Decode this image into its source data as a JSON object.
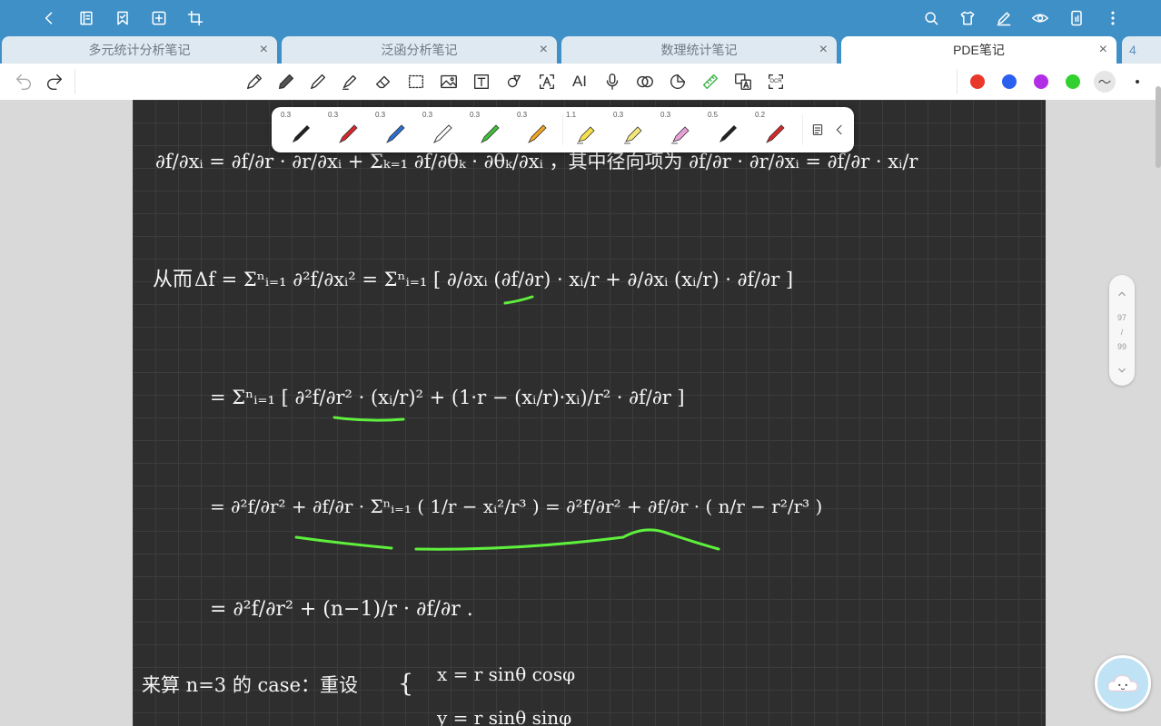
{
  "tabs": [
    {
      "label": "多元统计分析笔记",
      "active": false
    },
    {
      "label": "泛函分析笔记",
      "active": false
    },
    {
      "label": "数理统计笔记",
      "active": false
    },
    {
      "label": "PDE笔记",
      "active": true
    }
  ],
  "tabs_more_count": "4",
  "tab_close_glyph": "×",
  "colors": {
    "app_bar": "#3f90c7",
    "canvas": "#2e2e2e",
    "highlight": "#5ef03c",
    "swatches": [
      "#e8382b",
      "#2a5ff0",
      "#b22ee6",
      "#33d12f"
    ]
  },
  "pen_palette": [
    {
      "width": "0.3",
      "color": "#222222",
      "icon": "pen-icon"
    },
    {
      "width": "0.3",
      "color": "#d9262c",
      "icon": "pen-icon"
    },
    {
      "width": "0.3",
      "color": "#2c6fd1",
      "icon": "pen-icon"
    },
    {
      "width": "0.3",
      "color": "#ffffff",
      "icon": "pen-icon"
    },
    {
      "width": "0.3",
      "color": "#3fbf3a",
      "icon": "pen-icon"
    },
    {
      "width": "0.3",
      "color": "#f2a41f",
      "icon": "pen-icon"
    },
    {
      "width": "1.1",
      "color": "#f5e04a",
      "icon": "highlighter-icon"
    },
    {
      "width": "0.3",
      "color": "#f2e57a",
      "icon": "highlighter-icon"
    },
    {
      "width": "0.3",
      "color": "#e9a0d6",
      "icon": "highlighter-icon"
    },
    {
      "width": "0.5",
      "color": "#222222",
      "icon": "pen-icon"
    },
    {
      "width": "0.2",
      "color": "#d9262c",
      "icon": "pen-icon"
    }
  ],
  "page_indicator": {
    "current": "97",
    "separator": "/",
    "total": "99"
  },
  "toolbar_ai_label": "AI",
  "toolbar_ocr_label": "OCR",
  "note": {
    "line1": "∂f/∂xᵢ = ∂f/∂r · ∂r/∂xᵢ + Σₖ₌₁ ∂f/∂θₖ · ∂θₖ/∂xᵢ ，其中径向项为 ∂f/∂r · ∂r/∂xᵢ = ∂f/∂r · xᵢ/r",
    "line2_prefix": "从而",
    "line2": "Δf = Σⁿᵢ₌₁ ∂²f/∂xᵢ² = Σⁿᵢ₌₁ [ ∂/∂xᵢ (∂f/∂r) · xᵢ/r + ∂/∂xᵢ (xᵢ/r) · ∂f/∂r ]",
    "line3": "= Σⁿᵢ₌₁ [ ∂²f/∂r² · (xᵢ/r)² + (1·r − (xᵢ/r)·xᵢ)/r² · ∂f/∂r ]",
    "line4": "= ∂²f/∂r² + ∂f/∂r · Σⁿᵢ₌₁ ( 1/r − xᵢ²/r³ ) = ∂²f/∂r² + ∂f/∂r · ( n/r − r²/r³ )",
    "line5": "= ∂²f/∂r² + (n−1)/r · ∂f/∂r .",
    "line6_prefix": "来算 n=3 的 case：重设",
    "line6": "x = r sinθ cosφ",
    "line7": "y = r sinθ sinφ"
  }
}
